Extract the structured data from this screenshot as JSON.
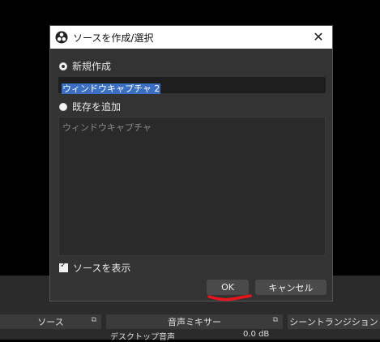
{
  "dialog": {
    "title": "ソースを作成/選択",
    "close_glyph": "✕",
    "create_new_label": "新規作成",
    "new_source_name": "ウィンドウキャプチャ 2",
    "add_existing_label": "既存を追加",
    "existing_sources": [
      "ウィンドウキャプチャ"
    ],
    "show_source_label": "ソースを表示",
    "show_source_checked": true,
    "ok_label": "OK",
    "cancel_label": "キャンセル"
  },
  "background": {
    "sources_header": "ソース",
    "mixer_header": "音声ミキサー",
    "transitions_header": "シーントランジション",
    "dock_glyph": "⧉",
    "mixer_channel": "デスクトップ音声",
    "mixer_level": "0.0 dB"
  },
  "colors": {
    "annotation_red": "#e8141c",
    "selection_blue": "#3a6fc4"
  }
}
